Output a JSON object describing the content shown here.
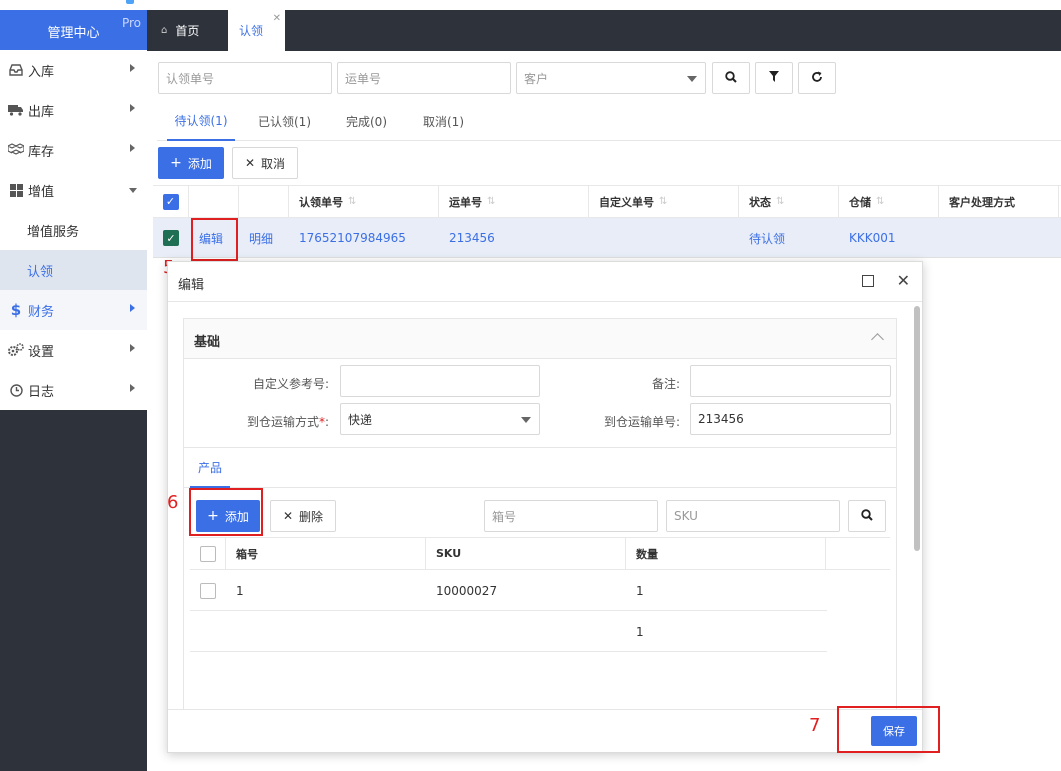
{
  "app": {
    "brand": "管理中心",
    "badge": "Pro"
  },
  "colors": {
    "accent": "#3b6fe6",
    "sidebar_bg": "#2e323b",
    "highlight_red": "#e02020",
    "checkbox_green": "#1f6f54"
  },
  "sidebar": {
    "items": [
      {
        "label": "入库",
        "icon": "inbox-icon"
      },
      {
        "label": "出库",
        "icon": "truck-icon"
      },
      {
        "label": "库存",
        "icon": "boxes-icon"
      },
      {
        "label": "增值",
        "icon": "grid-icon"
      },
      {
        "label": "增值服务"
      },
      {
        "label": "认领"
      },
      {
        "label": "财务",
        "icon": "dollar-icon"
      },
      {
        "label": "设置",
        "icon": "gears-icon"
      },
      {
        "label": "日志",
        "icon": "clock-icon"
      }
    ]
  },
  "tabs": [
    {
      "label": "首页",
      "icon": "home-icon"
    },
    {
      "label": "认领"
    }
  ],
  "filters": {
    "claim_no_placeholder": "认领单号",
    "waybill_placeholder": "运单号",
    "customer_placeholder": "客户"
  },
  "status_tabs": [
    "待认领(1)",
    "已认领(1)",
    "完成(0)",
    "取消(1)"
  ],
  "toolbar": {
    "add_label": "添加",
    "cancel_label": "取消"
  },
  "grid": {
    "columns": [
      "认领单号",
      "运单号",
      "自定义单号",
      "状态",
      "仓储",
      "客户处理方式"
    ],
    "row": {
      "edit": "编辑",
      "detail": "明细",
      "claim_no": "17652107984965",
      "waybill": "213456",
      "custom_no": "",
      "status": "待认领",
      "warehouse": "KKK001",
      "handling": ""
    }
  },
  "annotations": {
    "n5": "5",
    "n6": "6",
    "n7": "7"
  },
  "modal": {
    "title": "编辑",
    "section_title": "基础",
    "fields": {
      "custom_ref_label": "自定义参考号:",
      "custom_ref_value": "",
      "remark_label": "备注:",
      "remark_value": "",
      "transport_label": "到仓运输方式",
      "transport_required": "*",
      "transport_colon": ":",
      "transport_value": "快递",
      "transport_no_label": "到仓运输单号:",
      "transport_no_value": "213456"
    },
    "product_tab": "产品",
    "product_toolbar": {
      "add_label": "添加",
      "delete_label": "删除",
      "box_placeholder": "箱号",
      "sku_placeholder": "SKU"
    },
    "product_columns": [
      "箱号",
      "SKU",
      "数量"
    ],
    "product_rows": [
      {
        "box": "1",
        "sku": "10000027",
        "qty": "1"
      },
      {
        "box": "",
        "sku": "",
        "qty": "1"
      }
    ],
    "save_label": "保存"
  }
}
